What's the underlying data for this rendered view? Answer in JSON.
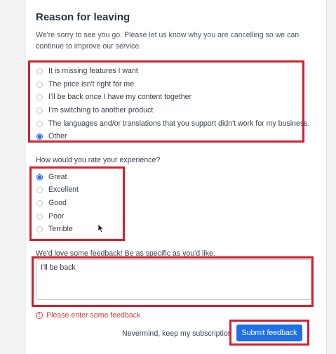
{
  "form": {
    "title": "Reason for leaving",
    "intro": "We're sorry to see you go. Please let us know why you are cancelling so we can continue to improve our service."
  },
  "reasons": {
    "options": [
      {
        "label": "It is missing features I want",
        "checked": false
      },
      {
        "label": "The price isn't right for me",
        "checked": false
      },
      {
        "label": "I'll be back once I have my content together",
        "checked": false
      },
      {
        "label": "I'm switching to another product",
        "checked": false
      },
      {
        "label": "The languages and/or translations that you support didn't work for my business.",
        "checked": false
      },
      {
        "label": "Other",
        "checked": true
      }
    ]
  },
  "rating": {
    "question": "How would you rate your experience?",
    "options": [
      {
        "label": "Great",
        "checked": true
      },
      {
        "label": "Excellent",
        "checked": false
      },
      {
        "label": "Good",
        "checked": false
      },
      {
        "label": "Poor",
        "checked": false
      },
      {
        "label": "Terrible",
        "checked": false
      }
    ]
  },
  "feedback": {
    "label": "We'd love some feedback! Be as specific as you'd like.",
    "value": "I'll be back",
    "error": "Please enter some feedback",
    "error_icon": "!"
  },
  "actions": {
    "cancel_label": "Nevermind, keep my subscription",
    "submit_label": "Submit feedback"
  },
  "colors": {
    "accent": "#1f6fe5",
    "error": "#d13b3b",
    "highlight_box": "#d4202c"
  }
}
